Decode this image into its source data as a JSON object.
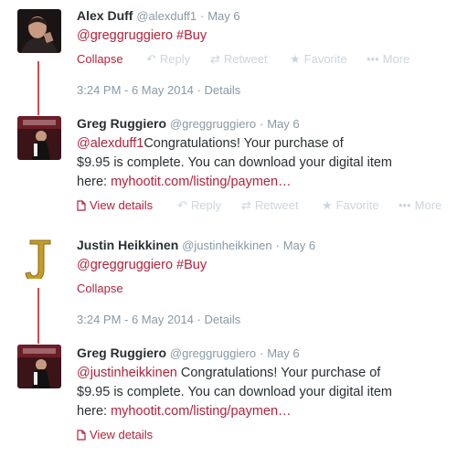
{
  "tweets": [
    {
      "name": "Alex Duff",
      "handle": "@alexduff1",
      "sep": "·",
      "date": "May 6",
      "mention": "@greggruggiero",
      "hashtag": "#Buy",
      "primary_action": "Collapse"
    },
    {
      "name": "Greg Ruggiero",
      "handle": "@greggruggiero",
      "sep": "·",
      "date": "May 6",
      "mention": "@alexduff1",
      "body_line1": "Congratulations! Your purchase of",
      "body_line2": "$9.95 is complete. You can download your digital item",
      "body_line3_prefix": "here: ",
      "link": "myhootit.com/listing/paymen…",
      "primary_action": "View details"
    },
    {
      "name": "Justin Heikkinen",
      "handle": "@justinheikkinen",
      "sep": "·",
      "date": "May 6",
      "mention": "@greggruggiero",
      "hashtag": "#Buy",
      "primary_action": "Collapse"
    },
    {
      "name": "Greg Ruggiero",
      "handle": "@greggruggiero",
      "sep": "·",
      "date": "May 6",
      "mention": "@justinheikkinen",
      "body_line1": " Congratulations! Your purchase of",
      "body_line2": "$9.95 is complete. You can download your digital item",
      "body_line3_prefix": "here: ",
      "link": "myhootit.com/listing/paymen…",
      "primary_action": "View details"
    }
  ],
  "actions": {
    "reply": "Reply",
    "retweet": "Retweet",
    "favorite": "Favorite",
    "more": "More",
    "reply_icon": "reply-icon",
    "retweet_icon": "retweet-icon",
    "favorite_icon": "star-icon",
    "more_icon": "ellipsis-icon"
  },
  "meta": [
    {
      "timestamp": "3:24 PM - 6 May 2014",
      "sep": "·",
      "details": "Details"
    },
    {
      "timestamp": "3:24 PM - 6 May 2014",
      "sep": "·",
      "details": "Details"
    }
  ],
  "colors": {
    "link": "#b0243c",
    "thread_line": "#cc4b55",
    "muted": "#8899a6",
    "faded_action": "#ccd6dd"
  }
}
